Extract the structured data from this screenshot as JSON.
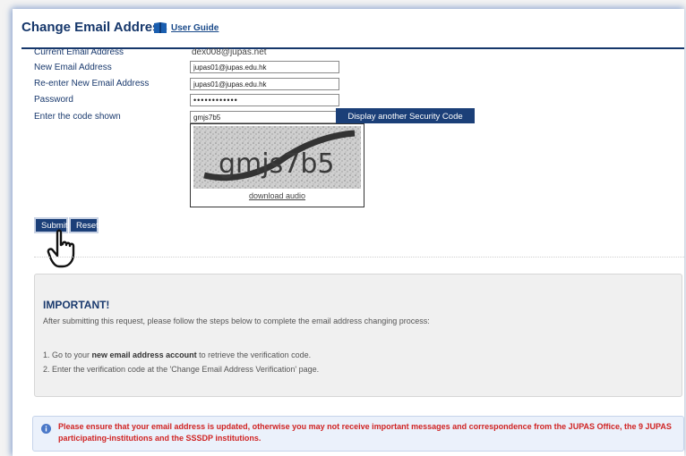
{
  "header": {
    "title": "Change Email Address",
    "user_guide_label": "User Guide"
  },
  "form": {
    "current_email_label": "Current Email Address",
    "current_email_value": "dex008@jupas.net",
    "new_email_label": "New Email Address",
    "new_email_value": "jupas01@jupas.edu.hk",
    "reenter_email_label": "Re-enter New Email Address",
    "reenter_email_value": "jupas01@jupas.edu.hk",
    "password_label": "Password",
    "password_value": "••••••••••••",
    "code_label": "Enter the code shown",
    "code_value": "gmjs7b5",
    "display_another_code_label": "Display another Security Code",
    "captcha_text": "gmjs7b5",
    "download_audio_label": "download audio"
  },
  "actions": {
    "submit_label": "Submit",
    "reset_label": "Reset"
  },
  "important": {
    "title": "IMPORTANT!",
    "intro": "After submitting this request, please follow the steps below to complete the email address changing process:",
    "step1_prefix": "1.  Go to your ",
    "step1_bold": "new email address account",
    "step1_suffix": " to retrieve the verification code.",
    "step2": "2.  Enter the verification code at the 'Change Email Address Verification' page."
  },
  "notice": {
    "text": "Please ensure that your email address is updated, otherwise you may not receive important messages and correspondence from the JUPAS Office, the 9 JUPAS participating-institutions and the SSSDP institutions."
  },
  "colors": {
    "brand_navy": "#1b3f78",
    "title_blue": "#16376b",
    "warning_red": "#d02424"
  },
  "icons": {
    "guide": "book-icon",
    "pointer": "hand-pointer-icon",
    "notice": "info-icon"
  }
}
